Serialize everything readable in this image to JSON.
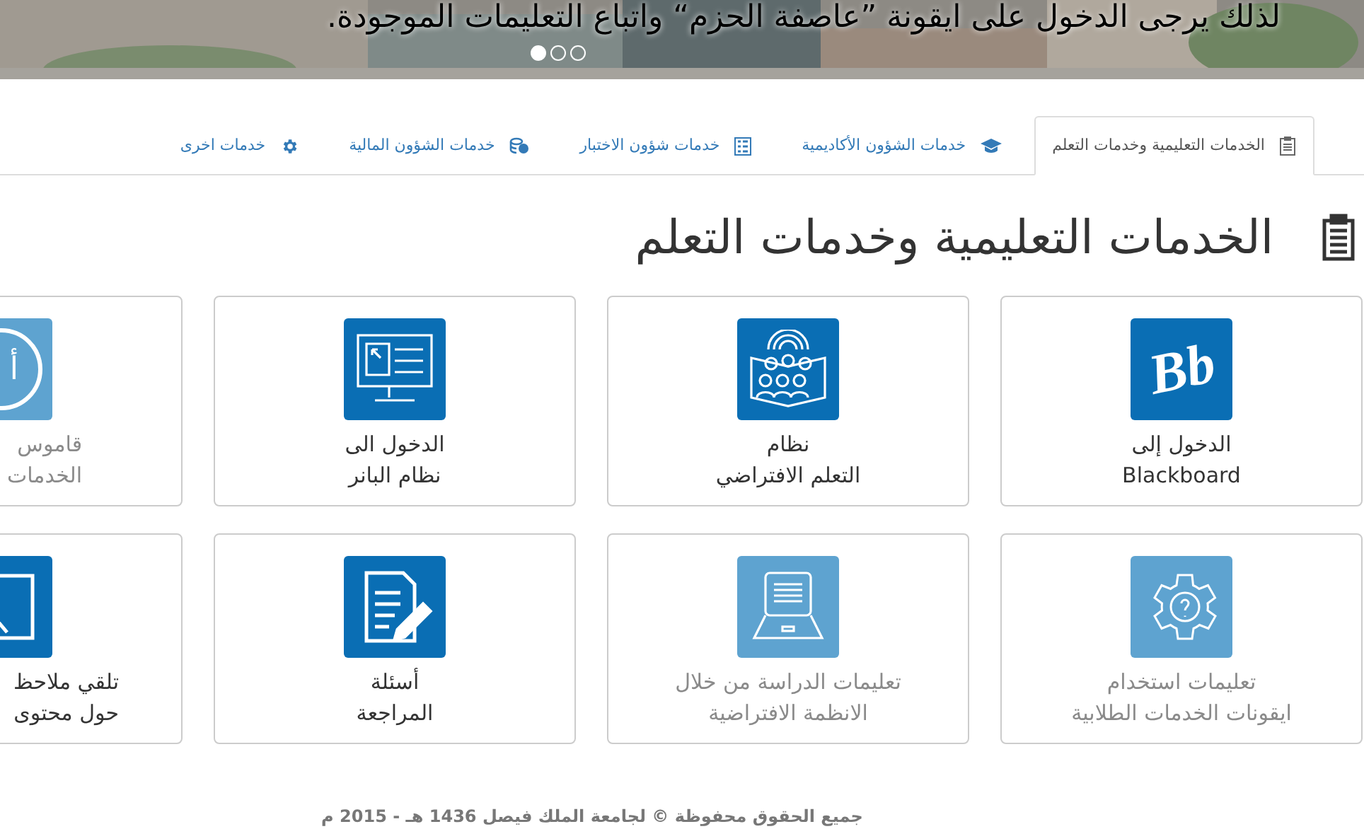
{
  "banner": {
    "caption": "لذلك يرجى الدخول على ايقونة ”عاصفة الحزم“ واتباع التعليمات الموجودة.",
    "dots": [
      {
        "selected": true
      },
      {
        "selected": false
      },
      {
        "selected": false
      }
    ]
  },
  "tabs": [
    {
      "label": "الخدمات التعليمية وخدمات التعلم",
      "kind": "clipboard",
      "selected": true
    },
    {
      "label": "خدمات الشؤون الأكاديمية",
      "kind": "cap",
      "selected": false
    },
    {
      "label": "خدمات شؤون الاختبار",
      "kind": "list",
      "selected": false
    },
    {
      "label": "خدمات الشؤون المالية",
      "kind": "coins",
      "selected": false
    },
    {
      "label": "خدمات اخرى",
      "kind": "gear",
      "selected": false
    }
  ],
  "heading": "الخدمات التعليمية وخدمات التعلم",
  "cards": [
    {
      "kind": "logo",
      "logo_text": "Bb",
      "lines": [
        "الدخول إلى",
        "Blackboard"
      ],
      "disabled": false
    },
    {
      "kind": "classroom",
      "lines": [
        "نظام",
        "التعلم الافتراضي"
      ],
      "disabled": false
    },
    {
      "kind": "screen",
      "lines": [
        "الدخول الى",
        "نظام البانر"
      ],
      "disabled": false
    },
    {
      "kind": "dictionary",
      "logo_text": "أ",
      "lines": [
        "قاموس",
        "الخدمات"
      ],
      "disabled": true
    },
    {
      "kind": "gear",
      "lines": [
        "تعليمات استخدام",
        "ايقونات الخدمات الطلابية"
      ],
      "disabled": true
    },
    {
      "kind": "laptop",
      "lines": [
        "تعليمات الدراسة من خلال",
        "الانظمة الافتراضية"
      ],
      "disabled": true
    },
    {
      "kind": "document",
      "lines": [
        "أسئلة",
        "المراجعة"
      ],
      "disabled": false
    },
    {
      "kind": "feedback",
      "lines": [
        "تلقي ملاحظ",
        "حول محتوى"
      ],
      "disabled": false
    }
  ],
  "footer": "جميع الحقوق محفوظة © لجامعة الملك فيصل 1436 هـ - 2015 م"
}
